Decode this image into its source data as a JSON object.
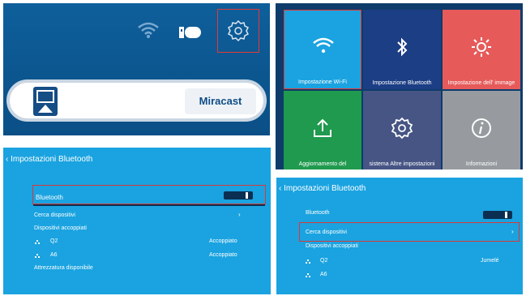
{
  "home": {
    "cast_button_label": "Miracast"
  },
  "tiles": [
    {
      "label": "Impostazione Wi-Fi",
      "color": "#1aa3e0",
      "icon": "wifi-icon"
    },
    {
      "label": "Impostazione Bluetooth",
      "color": "#1c3e84",
      "icon": "bluetooth-icon"
    },
    {
      "label": "Impostazione dell' immage",
      "color": "#e65a5a",
      "icon": "sun-icon"
    },
    {
      "label": "Aggiornamento del",
      "color": "#1f9a4e",
      "icon": "upload-icon"
    },
    {
      "label": "sistema Altre impostazioni",
      "color": "#475584",
      "icon": "gear-icon"
    },
    {
      "label": "Informazioni",
      "color": "#979b9f",
      "icon": "info-icon"
    }
  ],
  "bt1": {
    "title": "Impostazioni Bluetooth",
    "bluetooth": "Bluetooth",
    "search": "Cerca dispositivi",
    "paired": "Dispositivi accoppiati",
    "devices": [
      {
        "name": "Q2",
        "status": "Accoppiato"
      },
      {
        "name": "A6",
        "status": "Accoppiato"
      }
    ],
    "available": "Attrezzatura disponibile"
  },
  "bt2": {
    "title": "Impostazioni Bluetooth",
    "bluetooth": "Bluetooth",
    "search": "Cerca dispositivi",
    "paired": "Dispositivi accoppiati",
    "devices": [
      {
        "name": "Q2",
        "status": "Jumelé"
      },
      {
        "name": "A6",
        "status": ""
      }
    ]
  }
}
